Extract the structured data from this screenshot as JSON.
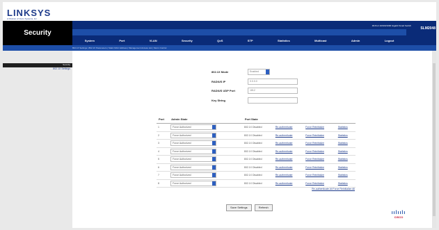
{
  "brand": {
    "logo": "LINKSYS",
    "tagline": "A Division of Cisco Systems, Inc."
  },
  "header": {
    "section_title": "Security",
    "model": "SLM2048",
    "device_name": "48-Port 10/100/1000 Gigabit Smart Switch",
    "tabs": [
      "System",
      "Port",
      "VLAN",
      "Security",
      "QoS",
      "STP",
      "Statistics",
      "Multicast",
      "Admin",
      "Logout"
    ]
  },
  "breadcrumb": "802.1X Settings | 802.1X Parameters | Static MAC Address | Management Access List | Storm Control",
  "sidebar": {
    "heading": "Security",
    "items": [
      "802.1X Settings"
    ]
  },
  "form": {
    "mode_label": "802.1X Mode",
    "mode_value": "Enabled",
    "radius_ip_label": "RADIUS IP",
    "radius_ip_value": "0.0.0.0",
    "radius_port_label": "RADIUS UDP Port",
    "radius_port_value": "1812",
    "key_label": "Key String",
    "key_value": ""
  },
  "table": {
    "headers": [
      "Port",
      "Admin State",
      "Port State",
      "",
      "",
      ""
    ],
    "rows": [
      {
        "port": "1",
        "admin": "Force Authorized",
        "state": "802.1X Disabled",
        "reauth": "Re-authenticate",
        "force": "Force Reinitialize",
        "stats": "Statistics"
      },
      {
        "port": "2",
        "admin": "Force Authorized",
        "state": "802.1X Disabled",
        "reauth": "Re-authenticate",
        "force": "Force Reinitialize",
        "stats": "Statistics"
      },
      {
        "port": "3",
        "admin": "Force Authorized",
        "state": "802.1X Disabled",
        "reauth": "Re-authenticate",
        "force": "Force Reinitialize",
        "stats": "Statistics"
      },
      {
        "port": "4",
        "admin": "Force Authorized",
        "state": "802.1X Disabled",
        "reauth": "Re-authenticate",
        "force": "Force Reinitialize",
        "stats": "Statistics"
      },
      {
        "port": "5",
        "admin": "Force Authorized",
        "state": "802.1X Disabled",
        "reauth": "Re-authenticate",
        "force": "Force Reinitialize",
        "stats": "Statistics"
      },
      {
        "port": "6",
        "admin": "Force Authorized",
        "state": "802.1X Disabled",
        "reauth": "Re-authenticate",
        "force": "Force Reinitialize",
        "stats": "Statistics"
      },
      {
        "port": "7",
        "admin": "Force Authorized",
        "state": "802.1X Disabled",
        "reauth": "Re-authenticate",
        "force": "Force Reinitialize",
        "stats": "Statistics"
      },
      {
        "port": "8",
        "admin": "Force Authorized",
        "state": "802.1X Disabled",
        "reauth": "Re-authenticate",
        "force": "Force Reinitialize",
        "stats": "Statistics"
      }
    ],
    "reauth_all": "Re-authenticate All Force Reinitialize All"
  },
  "buttons": {
    "save": "Save Settings",
    "refresh": "Refresh"
  },
  "footer": {
    "cisco": "CISCO"
  },
  "colors": {
    "navy": "#0a2b78",
    "blue": "#1d4ea8",
    "accent": "#c8102e"
  }
}
